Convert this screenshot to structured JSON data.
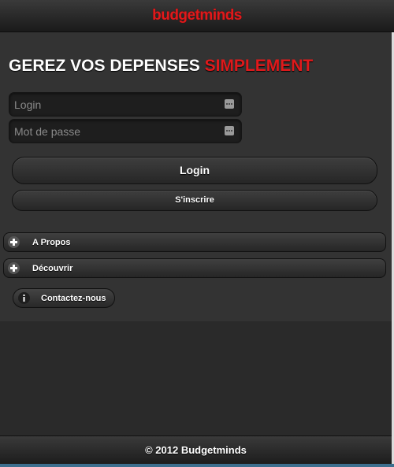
{
  "header": {
    "logo_text": "budgetminds",
    "brand_color": "#e0191b"
  },
  "headline": {
    "main": "GEREZ VOS DEPENSES ",
    "accent": "SIMPLEMENT"
  },
  "form": {
    "login_placeholder": "Login",
    "password_placeholder": "Mot de passe",
    "login_value": "",
    "password_value": ""
  },
  "buttons": {
    "login_label": "Login",
    "register_label": "S'inscrire"
  },
  "sections": [
    {
      "label": "A Propos",
      "icon": "plus-icon",
      "expanded": false
    },
    {
      "label": "Découvrir",
      "icon": "plus-icon",
      "expanded": false
    }
  ],
  "contact": {
    "label": "Contactez-nous",
    "icon": "info-icon"
  },
  "footer": {
    "text": "© 2012 Budgetminds"
  }
}
